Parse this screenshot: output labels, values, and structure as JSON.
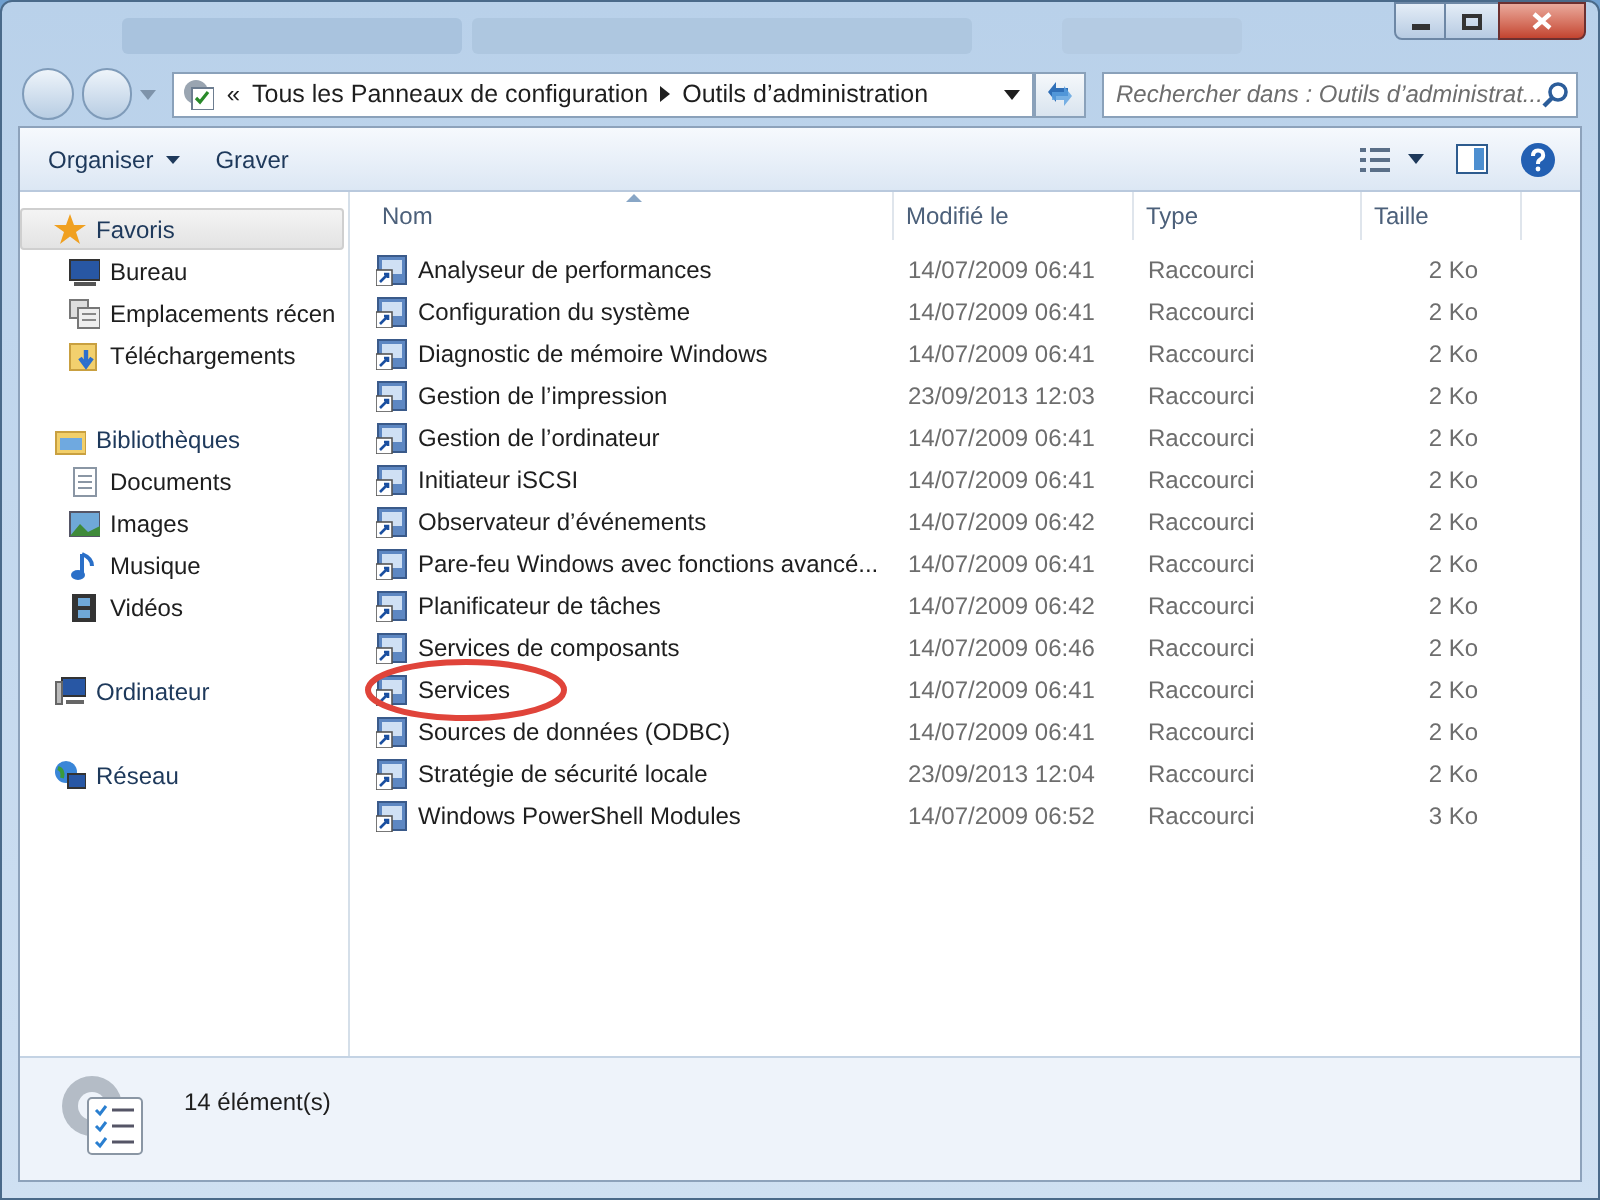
{
  "address_bar": {
    "overflow": "«",
    "crumbs": [
      "Tous les Panneaux de configuration",
      "Outils d’administration"
    ]
  },
  "search": {
    "placeholder": "Rechercher dans : Outils d’administrat..."
  },
  "toolbar": {
    "buttons": [
      {
        "label": "Organiser",
        "dropdown": true
      },
      {
        "label": "Graver",
        "dropdown": false
      }
    ]
  },
  "sidebar": {
    "groups": [
      {
        "label": "Favoris",
        "kind": "star",
        "selected": true,
        "children": [
          {
            "label": "Bureau",
            "kind": "desktop"
          },
          {
            "label": "Emplacements récen",
            "kind": "recent"
          },
          {
            "label": "Téléchargements",
            "kind": "download"
          }
        ]
      },
      {
        "label": "Bibliothèques",
        "kind": "library",
        "selected": false,
        "children": [
          {
            "label": "Documents",
            "kind": "document"
          },
          {
            "label": "Images",
            "kind": "image"
          },
          {
            "label": "Musique",
            "kind": "music"
          },
          {
            "label": "Vidéos",
            "kind": "video"
          }
        ]
      },
      {
        "label": "Ordinateur",
        "kind": "computer",
        "selected": false
      },
      {
        "label": "Réseau",
        "kind": "network",
        "selected": false
      }
    ]
  },
  "table": {
    "columns": [
      "Nom",
      "Modifié le",
      "Type",
      "Taille"
    ],
    "rows": [
      {
        "name": "Analyseur de performances",
        "modified": "14/07/2009 06:41",
        "type": "Raccourci",
        "size": "2 Ko",
        "circled": false
      },
      {
        "name": "Configuration du système",
        "modified": "14/07/2009 06:41",
        "type": "Raccourci",
        "size": "2 Ko",
        "circled": false
      },
      {
        "name": "Diagnostic de mémoire Windows",
        "modified": "14/07/2009 06:41",
        "type": "Raccourci",
        "size": "2 Ko",
        "circled": false
      },
      {
        "name": "Gestion de l’impression",
        "modified": "23/09/2013 12:03",
        "type": "Raccourci",
        "size": "2 Ko",
        "circled": false
      },
      {
        "name": "Gestion de l’ordinateur",
        "modified": "14/07/2009 06:41",
        "type": "Raccourci",
        "size": "2 Ko",
        "circled": false
      },
      {
        "name": "Initiateur iSCSI",
        "modified": "14/07/2009 06:41",
        "type": "Raccourci",
        "size": "2 Ko",
        "circled": false
      },
      {
        "name": "Observateur d’événements",
        "modified": "14/07/2009 06:42",
        "type": "Raccourci",
        "size": "2 Ko",
        "circled": false
      },
      {
        "name": "Pare-feu Windows avec fonctions avancé...",
        "modified": "14/07/2009 06:41",
        "type": "Raccourci",
        "size": "2 Ko",
        "circled": false
      },
      {
        "name": "Planificateur de tâches",
        "modified": "14/07/2009 06:42",
        "type": "Raccourci",
        "size": "2 Ko",
        "circled": false
      },
      {
        "name": "Services de composants",
        "modified": "14/07/2009 06:46",
        "type": "Raccourci",
        "size": "2 Ko",
        "circled": false
      },
      {
        "name": "Services",
        "modified": "14/07/2009 06:41",
        "type": "Raccourci",
        "size": "2 Ko",
        "circled": true
      },
      {
        "name": "Sources de données (ODBC)",
        "modified": "14/07/2009 06:41",
        "type": "Raccourci",
        "size": "2 Ko",
        "circled": false
      },
      {
        "name": "Stratégie de sécurité locale",
        "modified": "23/09/2013 12:04",
        "type": "Raccourci",
        "size": "2 Ko",
        "circled": false
      },
      {
        "name": "Windows PowerShell Modules",
        "modified": "14/07/2009 06:52",
        "type": "Raccourci",
        "size": "3 Ko",
        "circled": false
      }
    ]
  },
  "status_bar": {
    "count": "14 élément(s)"
  }
}
